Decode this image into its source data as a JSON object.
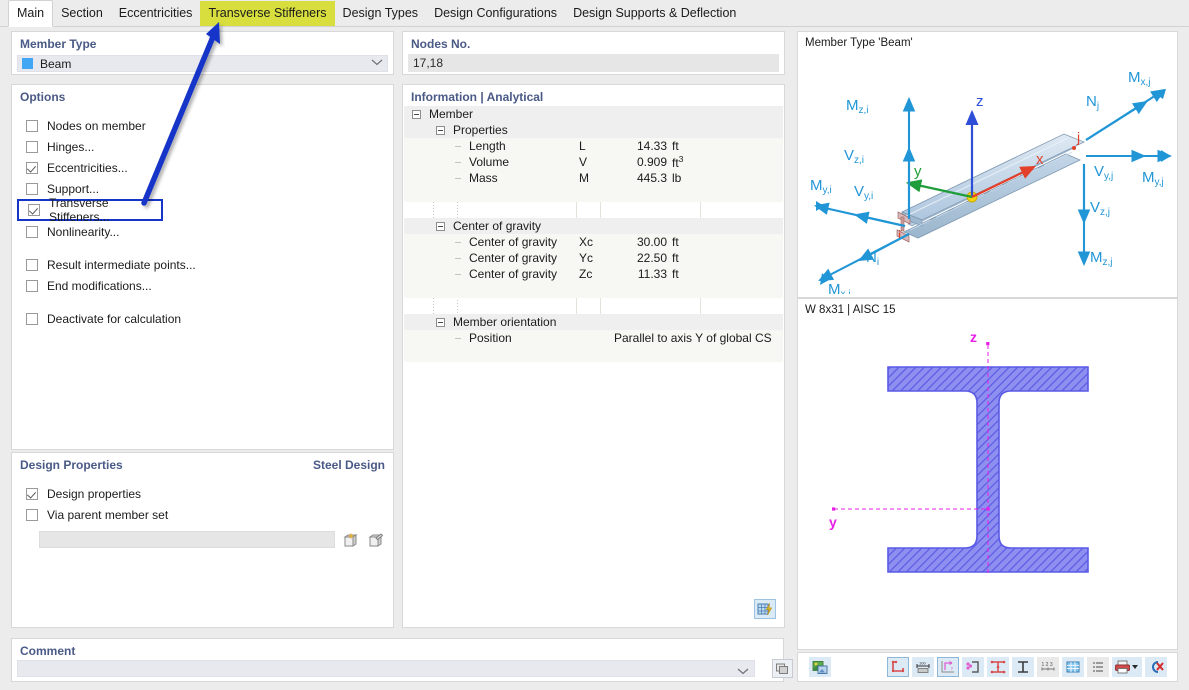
{
  "tabs": [
    {
      "label": "Main",
      "state": "active"
    },
    {
      "label": "Section",
      "state": "normal"
    },
    {
      "label": "Eccentricities",
      "state": "normal"
    },
    {
      "label": "Transverse Stiffeners",
      "state": "highlight"
    },
    {
      "label": "Design Types",
      "state": "normal"
    },
    {
      "label": "Design Configurations",
      "state": "normal"
    },
    {
      "label": "Design Supports & Deflection",
      "state": "normal"
    }
  ],
  "member_type": {
    "title": "Member Type",
    "value": "Beam",
    "swatch_color": "#41a7f5",
    "chevron": "chevron-down-icon"
  },
  "options": {
    "title": "Options",
    "items": [
      {
        "label": "Nodes on member",
        "checked": false,
        "boxed": false
      },
      {
        "label": "Hinges...",
        "checked": false,
        "boxed": false
      },
      {
        "label": "Eccentricities...",
        "checked": true,
        "boxed": false
      },
      {
        "label": "Support...",
        "checked": false,
        "boxed": false
      },
      {
        "label": "Transverse Stiffeners...",
        "checked": true,
        "boxed": true
      },
      {
        "label": "Nonlinearity...",
        "checked": false,
        "boxed": false
      },
      {
        "label": "Result intermediate points...",
        "checked": false,
        "boxed": false
      },
      {
        "label": "End modifications...",
        "checked": false,
        "boxed": false
      },
      {
        "label": "Deactivate for calculation",
        "checked": false,
        "boxed": false
      }
    ]
  },
  "design_properties": {
    "title": "Design Properties",
    "right_title": "Steel Design",
    "items": [
      {
        "label": "Design properties",
        "checked": true
      },
      {
        "label": "Via parent member set",
        "checked": false
      }
    ],
    "field_value": "",
    "buttons": [
      "new-member-set-icon",
      "edit-member-set-icon"
    ]
  },
  "comment": {
    "title": "Comment",
    "value": "",
    "chevron": "chevron-down-icon",
    "button_icon": "comment-pick-icon"
  },
  "nodes": {
    "title": "Nodes No.",
    "value": "17,18"
  },
  "information": {
    "title": "Information | Analytical",
    "grid_button_icon": "table-lightning-icon",
    "rows": [
      {
        "kind": "group",
        "indent": 0,
        "label": "Member"
      },
      {
        "kind": "group",
        "indent": 1,
        "label": "Properties"
      },
      {
        "kind": "leaf",
        "indent": 2,
        "label": "Length",
        "symbol": "L",
        "value": "14.33",
        "unit": "ft"
      },
      {
        "kind": "leaf",
        "indent": 2,
        "label": "Volume",
        "symbol": "V",
        "value": "0.909",
        "unit": "ft3",
        "unit_sup": "3",
        "unit_base": "ft"
      },
      {
        "kind": "leaf",
        "indent": 2,
        "label": "Mass",
        "symbol": "M",
        "value": "445.3",
        "unit": "lb"
      },
      {
        "kind": "spacer",
        "indent": 0,
        "label": ""
      },
      {
        "kind": "group",
        "indent": 1,
        "label": "Center of gravity"
      },
      {
        "kind": "leaf",
        "indent": 2,
        "label": "Center of gravity",
        "symbol": "Xc",
        "value": "30.00",
        "unit": "ft"
      },
      {
        "kind": "leaf",
        "indent": 2,
        "label": "Center of gravity",
        "symbol": "Yc",
        "value": "22.50",
        "unit": "ft"
      },
      {
        "kind": "leaf",
        "indent": 2,
        "label": "Center of gravity",
        "symbol": "Zc",
        "value": "11.33",
        "unit": "ft"
      },
      {
        "kind": "spacer",
        "indent": 0,
        "label": ""
      },
      {
        "kind": "group",
        "indent": 1,
        "label": "Member orientation"
      },
      {
        "kind": "wide",
        "indent": 2,
        "label": "Position",
        "value": "Parallel to axis Y of global CS"
      }
    ]
  },
  "beam_view": {
    "title": "Member Type 'Beam'",
    "axes": [
      {
        "name": "z",
        "color": "#2f4ed8"
      },
      {
        "name": "y",
        "color": "#1f9d3a"
      },
      {
        "name": "x",
        "color": "#e2402a"
      }
    ],
    "node_labels": [
      {
        "name": "i",
        "color": "#e2402a"
      },
      {
        "name": "j",
        "color": "#e2402a"
      }
    ],
    "force_labels": [
      "Mz,i",
      "Vz,i",
      "My,i",
      "Vy,i",
      "Ni",
      "Mx,i",
      "Nj",
      "Mx,j",
      "Vy,j",
      "My,j",
      "Vz,j",
      "Mz,j"
    ],
    "arrow_color": "#2196d6"
  },
  "section_view": {
    "title": "W 8x31 | AISC 15",
    "axis_labels": [
      {
        "name": "z",
        "color": "#e81ee8"
      },
      {
        "name": "y",
        "color": "#e81ee8"
      }
    ],
    "section_color": "#6f6fe8"
  },
  "right_toolbar": {
    "left_button": "render-view-icon",
    "buttons": [
      "section-outline-icon",
      "section-dimensions-icon",
      "section-axes-icon",
      "section-parts-icon",
      "stress-points-icon",
      "section-shape-icon",
      "numbering-icon",
      "grid-icon",
      "list-icon",
      "print-icon",
      "clear-selection-icon"
    ],
    "print_chevron": "chevron-down-icon"
  },
  "annotation": {
    "arrow_color": "#1534c8",
    "highlight_color": "#d7de3e"
  }
}
